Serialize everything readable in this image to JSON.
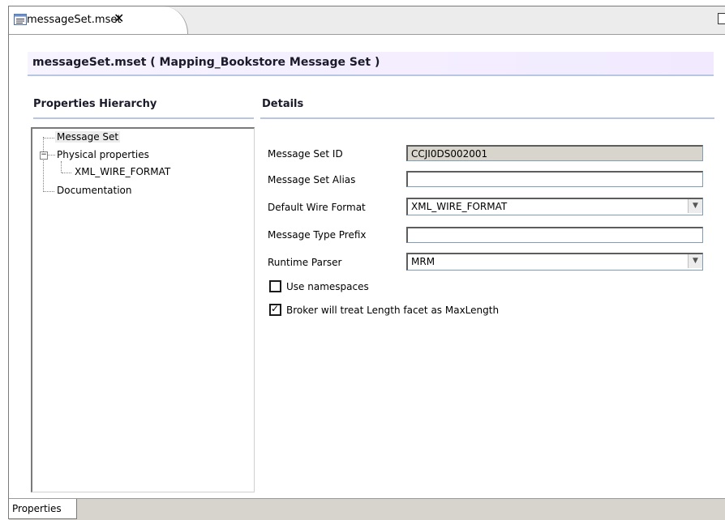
{
  "editor_tab": {
    "label": "messageSet.mset",
    "close": "✕"
  },
  "header": {
    "title": "messageSet.mset ( Mapping_Bookstore Message Set )"
  },
  "hierarchy": {
    "title": "Properties Hierarchy",
    "nodes": {
      "message_set": "Message Set",
      "physical_properties": "Physical properties",
      "xml_wire_format": "XML_WIRE_FORMAT",
      "documentation": "Documentation"
    }
  },
  "details": {
    "title": "Details",
    "message_set_id": {
      "label": "Message Set ID",
      "value": "CCJI0DS002001"
    },
    "message_set_alias": {
      "label": "Message Set Alias",
      "value": ""
    },
    "default_wire_format": {
      "label": "Default Wire Format",
      "value": "XML_WIRE_FORMAT"
    },
    "message_type_prefix": {
      "label": "Message Type Prefix",
      "value": ""
    },
    "runtime_parser": {
      "label": "Runtime Parser",
      "value": "MRM"
    },
    "use_namespaces": {
      "label": "Use namespaces",
      "checked": false
    },
    "length_as_maxlength": {
      "label": "Broker will treat Length facet as MaxLength",
      "checked": true
    }
  },
  "bottom_tabs": {
    "properties": "Properties"
  },
  "icons": {
    "editor_tab": "message-set-file-icon",
    "close": "close-icon",
    "maximize": "maximize-icon",
    "combo": "chevron-down-icon",
    "expander": "tree-collapse-icon"
  },
  "colors": {
    "header_band": "#f4efff",
    "section_rule": "#b8c5e3",
    "readonly_field": "#d8d5cc",
    "watermark": "#e8e8e8"
  }
}
